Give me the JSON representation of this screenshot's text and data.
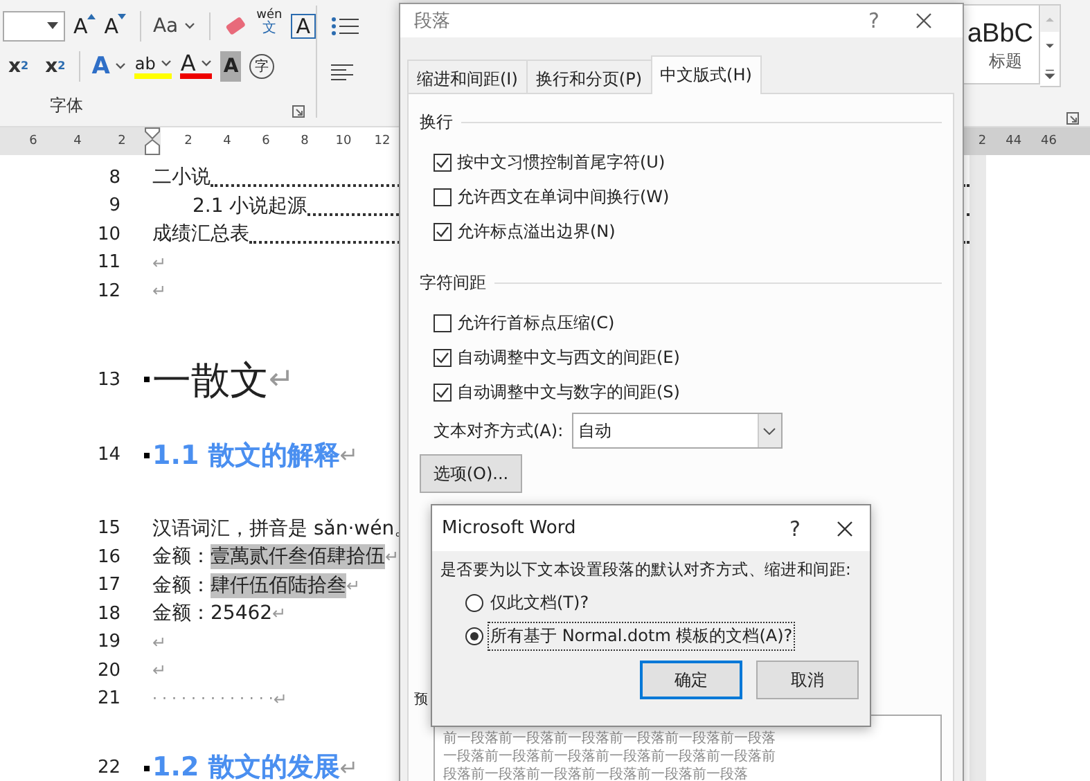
{
  "ribbon": {
    "row1": [
      {
        "kind": "grow",
        "text": "A"
      },
      {
        "kind": "shrink",
        "text": "A"
      },
      {
        "kind": "case",
        "text": "Aa"
      },
      {
        "kind": "eraser"
      },
      {
        "kind": "phonetic",
        "text": "wén",
        "sub": "文"
      },
      {
        "kind": "boxed",
        "text": "A"
      }
    ],
    "row2": [
      {
        "kind": "subscript",
        "text": "x",
        "sub": "2"
      },
      {
        "kind": "superscript",
        "text": "x",
        "sub": "2"
      },
      {
        "kind": "effects",
        "text": "A"
      },
      {
        "kind": "highlight",
        "text": "ab"
      },
      {
        "kind": "fontcolor",
        "text": "A"
      },
      {
        "kind": "shaded",
        "text": "A"
      },
      {
        "kind": "circled",
        "text": "字"
      }
    ],
    "group_label": "字体",
    "styles": {
      "sample": "aBbC",
      "label": "标题"
    }
  },
  "ruler": {
    "left_ticks": [
      "6",
      "4",
      "2"
    ],
    "ticks": [
      "2",
      "4",
      "6",
      "8",
      "10",
      "12"
    ],
    "right_ticks": [
      "2",
      "44",
      "46"
    ]
  },
  "document": {
    "lines": [
      {
        "number": "8",
        "kind": "toc",
        "text": "二小说",
        "indented": false
      },
      {
        "number": "9",
        "kind": "toc",
        "text": "2.1 小说起源",
        "indented": true
      },
      {
        "number": "10",
        "kind": "toc",
        "text": "成绩汇总表",
        "indented": false
      },
      {
        "number": "11",
        "kind": "empty",
        "mark": "↵"
      },
      {
        "number": "12",
        "kind": "empty",
        "mark": "↵"
      },
      {
        "number": "13",
        "kind": "heading1",
        "text": "一散文",
        "mark": "↵"
      },
      {
        "number": "14",
        "kind": "heading2",
        "text": "1.1 散文的解释",
        "mark": "↵"
      },
      {
        "number": "15",
        "kind": "body",
        "text": "汉语词汇，拼音是 sǎn·wén。"
      },
      {
        "number": "16",
        "kind": "amount",
        "label": "金额：",
        "value": "壹萬贰仟叁佰肆拾伍",
        "highlighted": true,
        "mark": "↵"
      },
      {
        "number": "17",
        "kind": "amount",
        "label": "金额：",
        "value": "肆仟伍佰陆拾叁",
        "highlighted": true,
        "mark": "↵"
      },
      {
        "number": "18",
        "kind": "amount",
        "label": "金额：",
        "value": "25462",
        "highlighted": false,
        "mark": "↵"
      },
      {
        "number": "19",
        "kind": "empty",
        "mark": "↵"
      },
      {
        "number": "20",
        "kind": "empty",
        "mark": "↵"
      },
      {
        "number": "21",
        "kind": "dots",
        "text": "· · · · · · · · · · · · ·",
        "mark": "↵"
      },
      {
        "number": "22",
        "kind": "heading2",
        "text": "1.2 散文的发展",
        "mark": "↵"
      }
    ]
  },
  "paragraph_dialog": {
    "title": "段落",
    "help": "?",
    "tabs": [
      {
        "label": "缩进和间距(I)",
        "selected": false
      },
      {
        "label": "换行和分页(P)",
        "selected": false
      },
      {
        "label": "中文版式(H)",
        "selected": true
      }
    ],
    "sections": [
      {
        "title": "换行",
        "items": [
          {
            "kind": "checkbox",
            "label": "按中文习惯控制首尾字符(U)",
            "checked": true
          },
          {
            "kind": "checkbox",
            "label": "允许西文在单词中间换行(W)",
            "checked": false
          },
          {
            "kind": "checkbox",
            "label": "允许标点溢出边界(N)",
            "checked": true
          }
        ]
      },
      {
        "title": "字符间距",
        "items": [
          {
            "kind": "checkbox",
            "label": "允许行首标点压缩(C)",
            "checked": false
          },
          {
            "kind": "checkbox",
            "label": "自动调整中文与西文的间距(E)",
            "checked": true
          },
          {
            "kind": "checkbox",
            "label": "自动调整中文与数字的间距(S)",
            "checked": true
          },
          {
            "kind": "select",
            "label": "文本对齐方式(A):",
            "value": "自动"
          },
          {
            "kind": "button",
            "label": "选项(O)..."
          }
        ]
      }
    ],
    "preview": {
      "title": "预",
      "lines": [
        "前一段落前一段落前一段落前一段落前一段落前一段落",
        "一段落前一段落前一段落前一段落前一段落前一段落前",
        "段落前一段落前一段落前一段落前一段落前一段落"
      ]
    }
  },
  "confirm_dialog": {
    "title": "Microsoft Word",
    "help": "?",
    "message": "是否要为以下文本设置段落的默认对齐方式、缩进和间距:",
    "options": [
      {
        "label": "仅此文档(T)?",
        "selected": false
      },
      {
        "label": "所有基于 Normal.dotm 模板的文档(A)?",
        "selected": true
      }
    ],
    "buttons": [
      {
        "label": "确定",
        "default": true
      },
      {
        "label": "取消",
        "default": false
      }
    ]
  }
}
